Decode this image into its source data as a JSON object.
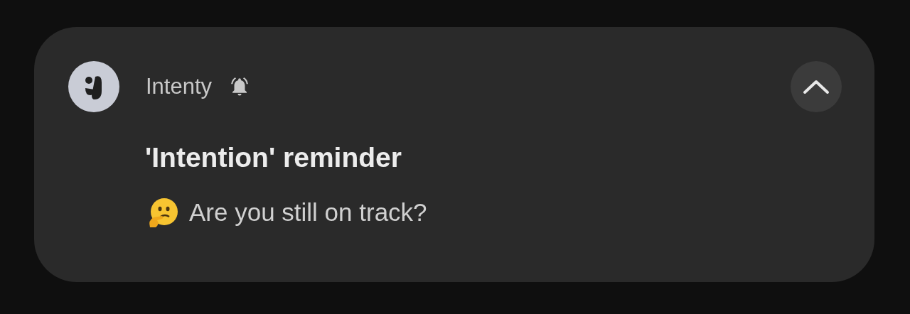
{
  "notification": {
    "app_name": "Intenty",
    "alerting": true,
    "expanded": true,
    "title": "'Intention' reminder",
    "message": "Are you still on track?"
  }
}
